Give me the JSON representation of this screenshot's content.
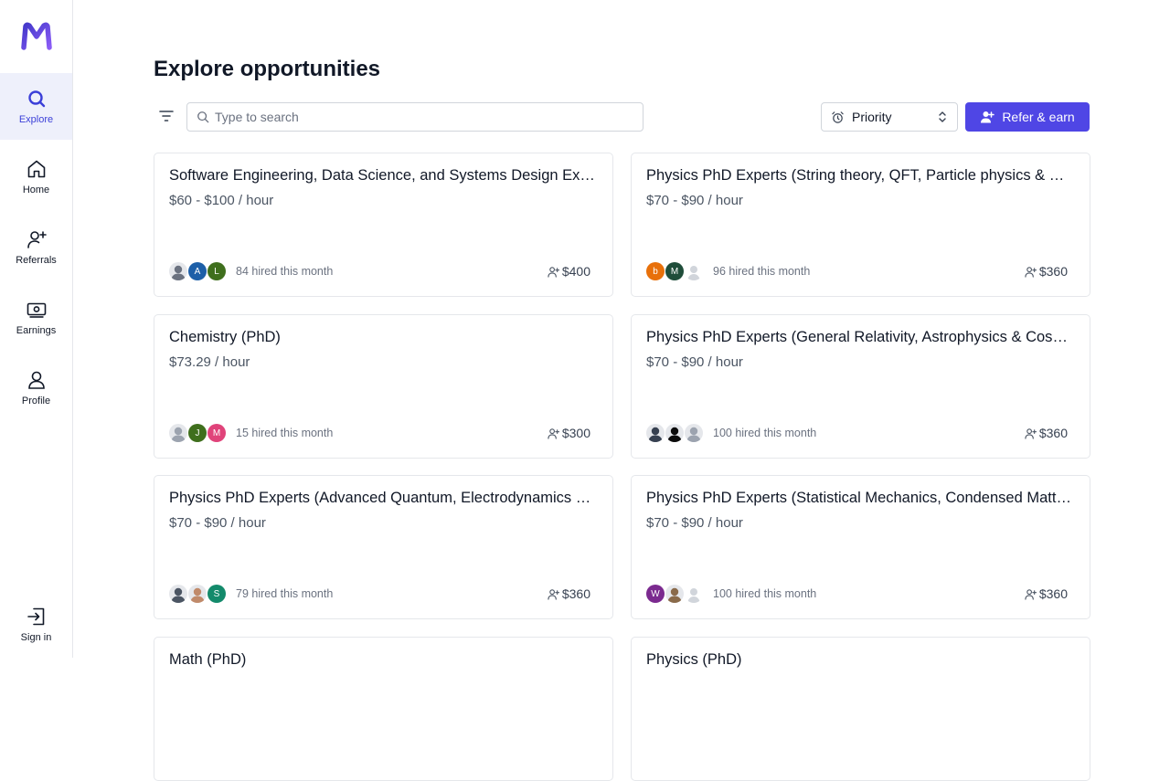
{
  "app": {
    "logo_letter": "M",
    "brand_color": "#4f46e5"
  },
  "nav": {
    "items": [
      {
        "label": "Explore",
        "icon": "search-icon",
        "active": true
      },
      {
        "label": "Home",
        "icon": "home-icon",
        "active": false
      },
      {
        "label": "Referrals",
        "icon": "user-plus-icon",
        "active": false
      },
      {
        "label": "Earnings",
        "icon": "money-icon",
        "active": false
      },
      {
        "label": "Profile",
        "icon": "user-icon",
        "active": false
      }
    ],
    "sign_in": {
      "label": "Sign in",
      "icon": "sign-in-icon"
    }
  },
  "page": {
    "title": "Explore opportunities"
  },
  "toolbar": {
    "search_placeholder": "Type to search",
    "search_value": "",
    "sort_label": "Priority",
    "refer_label": "Refer & earn"
  },
  "cards": [
    {
      "title": "Software Engineering, Data Science, and Systems Design Experts",
      "rate": "$60 - $100 / hour",
      "avatars": [
        {
          "type": "photo",
          "letter": "",
          "color": "#6b7280"
        },
        {
          "type": "letter",
          "letter": "A",
          "color": "#1d5fa8"
        },
        {
          "type": "letter",
          "letter": "L",
          "color": "#3f6f1d"
        }
      ],
      "hired": "84 hired this month",
      "bonus": "$400"
    },
    {
      "title": "Physics PhD Experts (String theory, QFT, Particle physics & more)",
      "rate": "$70 - $90 / hour",
      "avatars": [
        {
          "type": "letter",
          "letter": "b",
          "color": "#e8700a"
        },
        {
          "type": "letter",
          "letter": "M",
          "color": "#1f4d3a"
        },
        {
          "type": "placeholder",
          "letter": "",
          "color": "#e5e7eb"
        }
      ],
      "hired": "96 hired this month",
      "bonus": "$360"
    },
    {
      "title": "Chemistry (PhD)",
      "rate": "$73.29 / hour",
      "avatars": [
        {
          "type": "photo",
          "letter": "",
          "color": "#9ca3af"
        },
        {
          "type": "letter",
          "letter": "J",
          "color": "#3f6f1d"
        },
        {
          "type": "letter",
          "letter": "M",
          "color": "#e0437a"
        }
      ],
      "hired": "15 hired this month",
      "bonus": "$300"
    },
    {
      "title": "Physics PhD Experts (General Relativity, Astrophysics & Cosmology)",
      "rate": "$70 - $90 / hour",
      "avatars": [
        {
          "type": "photo",
          "letter": "",
          "color": "#374151"
        },
        {
          "type": "photo",
          "letter": "",
          "color": "#0b0b0b"
        },
        {
          "type": "photo",
          "letter": "",
          "color": "#9ca3af"
        }
      ],
      "hired": "100 hired this month",
      "bonus": "$360"
    },
    {
      "title": "Physics PhD Experts (Advanced Quantum, Electrodynamics & more)",
      "rate": "$70 - $90 / hour",
      "avatars": [
        {
          "type": "photo",
          "letter": "",
          "color": "#4b5563"
        },
        {
          "type": "photo",
          "letter": "",
          "color": "#c08a6a"
        },
        {
          "type": "letter",
          "letter": "S",
          "color": "#138a6b"
        }
      ],
      "hired": "79 hired this month",
      "bonus": "$360"
    },
    {
      "title": "Physics PhD Experts (Statistical Mechanics, Condensed Matter & more)",
      "rate": "$70 - $90 / hour",
      "avatars": [
        {
          "type": "letter",
          "letter": "W",
          "color": "#7b2a8f"
        },
        {
          "type": "photo",
          "letter": "",
          "color": "#8a6a4a"
        },
        {
          "type": "placeholder",
          "letter": "",
          "color": "#e5e7eb"
        }
      ],
      "hired": "100 hired this month",
      "bonus": "$360"
    },
    {
      "title": "Math (PhD)",
      "rate": "",
      "avatars": [],
      "hired": "",
      "bonus": ""
    },
    {
      "title": "Physics (PhD)",
      "rate": "",
      "avatars": [],
      "hired": "",
      "bonus": ""
    }
  ]
}
